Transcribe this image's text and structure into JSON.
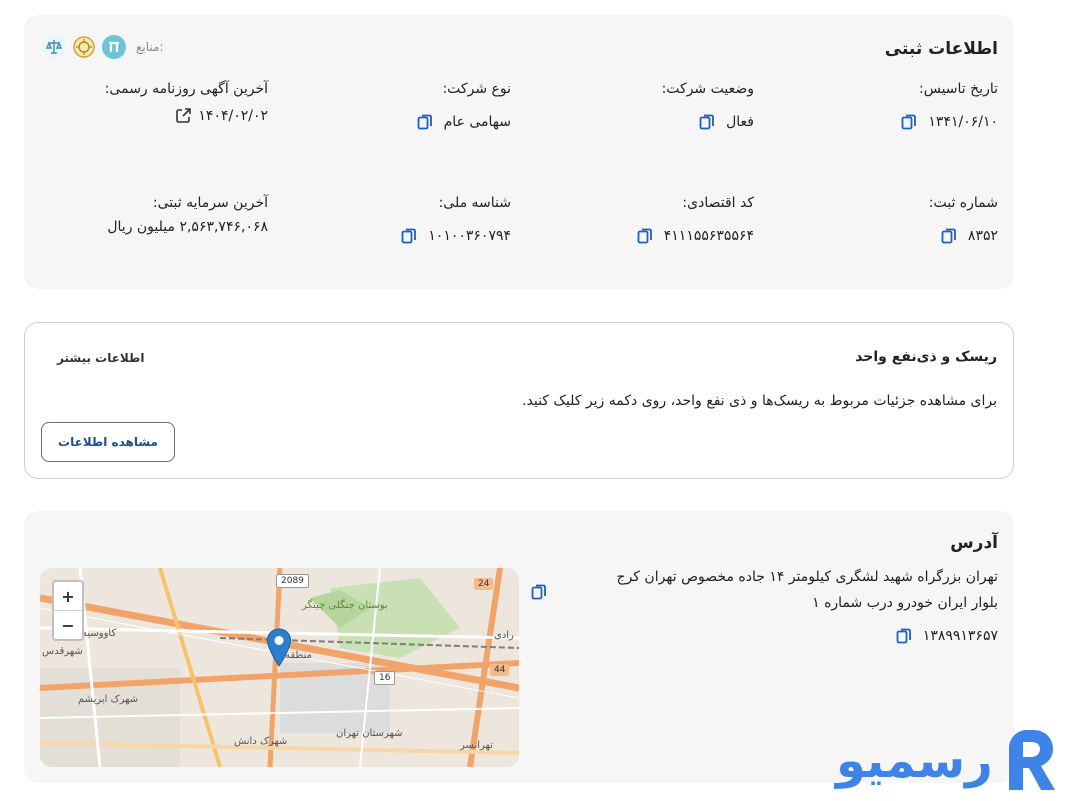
{
  "registration": {
    "title": "اطلاعات ثبتی",
    "sources_label": "منابع:",
    "fields": [
      {
        "label": "تاریخ تاسیس:",
        "value": "۱۳۴۱/۰۶/۱۰"
      },
      {
        "label": "وضعیت شرکت:",
        "value": "فعال"
      },
      {
        "label": "نوع شرکت:",
        "value": "سهامی عام"
      },
      {
        "label": "آخرین آگهی روزنامه رسمی:",
        "value": "۱۴۰۴/۰۲/۰۲"
      },
      {
        "label": "شماره ثبت:",
        "value": "۸۳۵۲"
      },
      {
        "label": "کد اقتصادی:",
        "value": "۴۱۱۱۵۵۶۳۵۵۶۴"
      },
      {
        "label": "شناسه ملی:",
        "value": "۱۰۱۰۰۳۶۰۷۹۴"
      },
      {
        "label": "آخرین سرمایه ثبتی:",
        "value": "۲,۵۶۳,۷۴۶,۰۶۸ میلیون ریال"
      }
    ]
  },
  "risk": {
    "title": "ریسک و ذی‌نفع واحد",
    "more_info": "اطلاعات بیشتر",
    "description": "برای مشاهده جزئیات مربوط به ریسک‌ها و ذی نفع واحد، روی دکمه زیر کلیک کنید.",
    "button_label": "مشاهده اطلاعات"
  },
  "address": {
    "title": "آدرس",
    "line1": "تهران بزرگراه شهید لشگری کیلومتر ۱۴ جاده مخصوص تهران کرج",
    "line2": "بلوار ایران خودرو درب شماره ۱",
    "postal_code": "۱۳۸۹۹۱۳۶۵۷"
  },
  "map": {
    "zoom_in": "+",
    "zoom_out": "−",
    "badges": [
      "2089",
      "24",
      "16",
      "44"
    ],
    "labels": [
      "کاووسیه",
      "شهرقدس",
      "شهرک ابریشم",
      "شهرک دانش",
      "بوستان جنگلی چیتگر",
      "شهرستان تهران",
      "منطقه",
      "تهرانسر",
      "رادی"
    ]
  },
  "brand": {
    "logo_text": "رسمیو"
  },
  "colors": {
    "accent": "#1d5fbf",
    "card_bg": "#f6f6f6",
    "logo": "#3e83e8"
  }
}
